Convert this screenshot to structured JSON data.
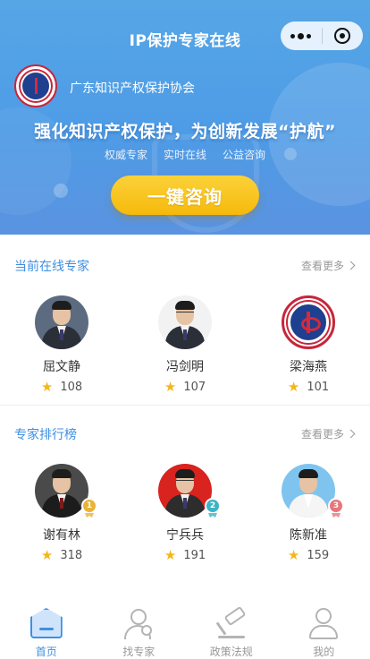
{
  "header": {
    "title": "IP保护专家在线",
    "capsule": {
      "more_icon": "more-dots-icon",
      "close_icon": "close-circle-icon"
    }
  },
  "hero": {
    "org_name": "广东知识产权保护协会",
    "slogan": "强化知识产权保护，为创新发展“护航”",
    "tags": [
      "权威专家",
      "实时在线",
      "公益咨询"
    ],
    "cta_label": "一键咨询"
  },
  "online_section": {
    "title": "当前在线专家",
    "more_label": "查看更多",
    "experts": [
      {
        "name": "屈文静",
        "score": "108"
      },
      {
        "name": "冯剑明",
        "score": "107"
      },
      {
        "name": "梁海燕",
        "score": "101"
      }
    ]
  },
  "ranking_section": {
    "title": "专家排行榜",
    "more_label": "查看更多",
    "experts": [
      {
        "name": "谢有林",
        "score": "318",
        "rank": "1"
      },
      {
        "name": "宁兵兵",
        "score": "191",
        "rank": "2"
      },
      {
        "name": "陈新准",
        "score": "159",
        "rank": "3"
      }
    ]
  },
  "tabbar": {
    "tabs": [
      {
        "label": "首页",
        "icon": "home-icon",
        "active": true
      },
      {
        "label": "找专家",
        "icon": "find-expert-icon",
        "active": false
      },
      {
        "label": "政策法规",
        "icon": "gavel-icon",
        "active": false
      },
      {
        "label": "我的",
        "icon": "user-icon",
        "active": false
      }
    ]
  },
  "colors": {
    "accent": "#3f8fe0",
    "cta": "#f6b90a",
    "star": "#f4b71a",
    "hero": "#56a6e6"
  }
}
